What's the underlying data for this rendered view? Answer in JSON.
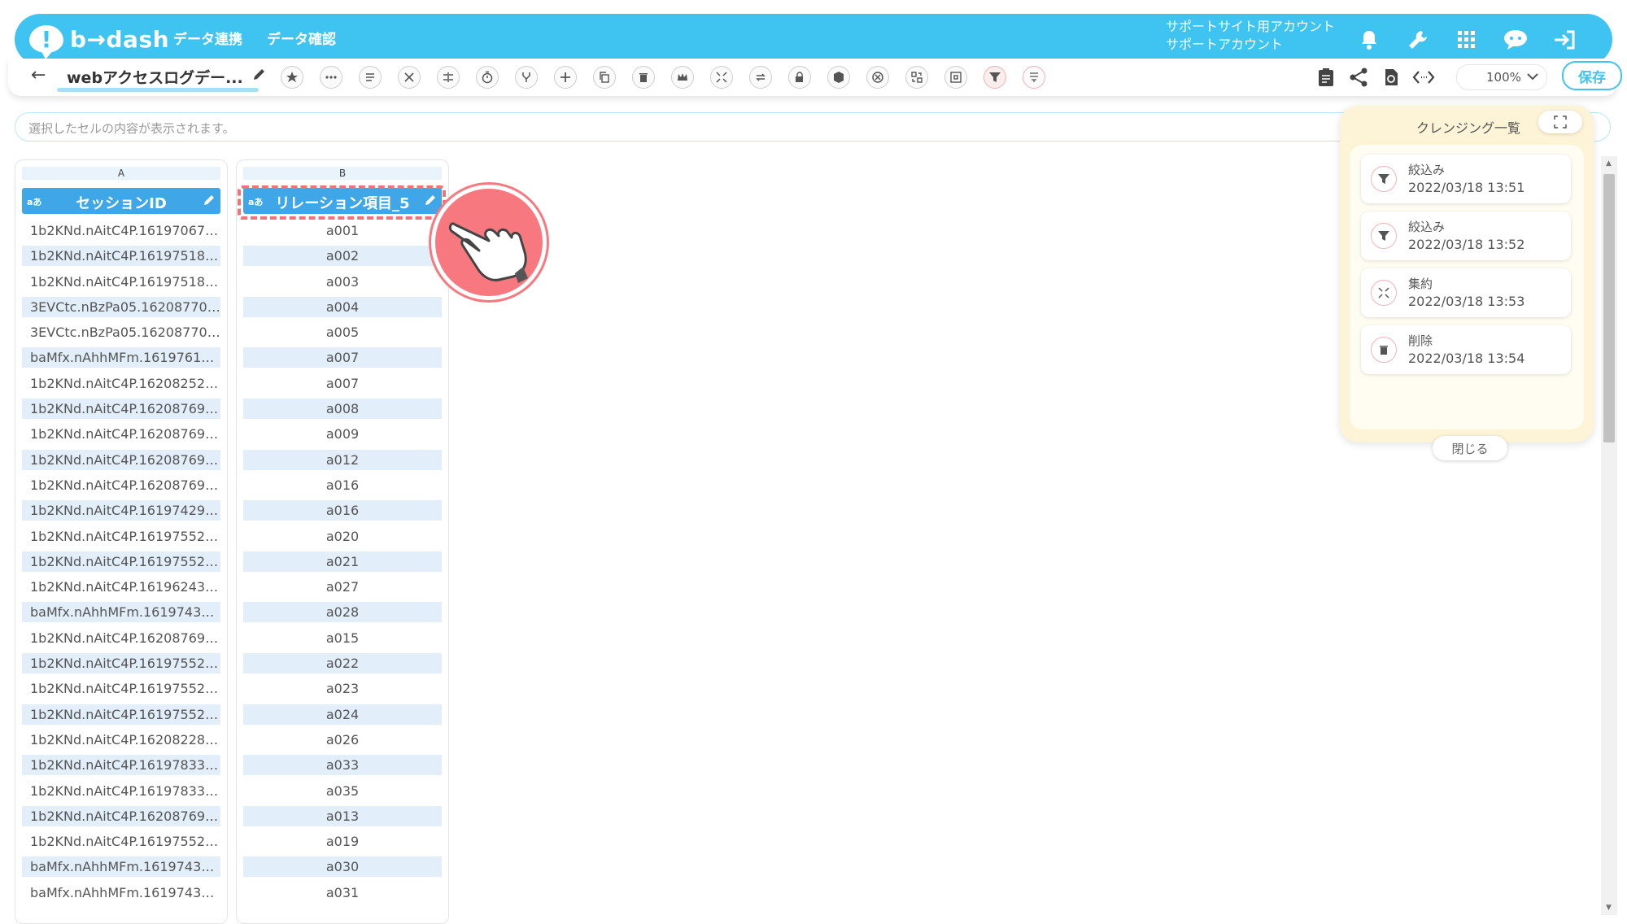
{
  "app": {
    "logo_text": "b→dash",
    "nav": [
      "データ連携",
      "データ確認"
    ],
    "account_line1": "サポートサイト用アカウント",
    "account_line2": "サポートアカウント"
  },
  "toolbar": {
    "back_icon": "←",
    "doc_title": "webアクセスログデー...",
    "zoom_value": "100%",
    "save_label": "保存"
  },
  "cellbar": {
    "placeholder": "選択したセルの内容が表示されます。"
  },
  "grid": {
    "columns": [
      {
        "letter": "A",
        "type_icon": "aあ",
        "header": "セッションID",
        "rows": [
          "1b2KNd.nAitC4P.161970677...",
          "1b2KNd.nAitC4P.161975180...",
          "1b2KNd.nAitC4P.161975180...",
          "3EVCtc.nBzPa05.162087702...",
          "3EVCtc.nBzPa05.162087702...",
          "baMfx.nAhhMFm.161976133...",
          "1b2KNd.nAitC4P.162082526...",
          "1b2KNd.nAitC4P.162087690...",
          "1b2KNd.nAitC4P.162087690...",
          "1b2KNd.nAitC4P.162087690...",
          "1b2KNd.nAitC4P.162087690...",
          "1b2KNd.nAitC4P.161974291...",
          "1b2KNd.nAitC4P.161975521...",
          "1b2KNd.nAitC4P.161975521...",
          "1b2KNd.nAitC4P.161962432...",
          "baMfx.nAhhMFm.161974348...",
          "1b2KNd.nAitC4P.162087690...",
          "1b2KNd.nAitC4P.161975521...",
          "1b2KNd.nAitC4P.161975521...",
          "1b2KNd.nAitC4P.161975521...",
          "1b2KNd.nAitC4P.162082280...",
          "1b2KNd.nAitC4P.161978330...",
          "1b2KNd.nAitC4P.161978330...",
          "1b2KNd.nAitC4P.162087690...",
          "1b2KNd.nAitC4P.161975521...",
          "baMfx.nAhhMFm.161974348...",
          "baMfx.nAhhMFm.161974348..."
        ]
      },
      {
        "letter": "B",
        "type_icon": "aあ",
        "header": "リレーション項目_5",
        "rows": [
          "a001",
          "a002",
          "a003",
          "a004",
          "a005",
          "a007",
          "a007",
          "a008",
          "a009",
          "a012",
          "a016",
          "a016",
          "a020",
          "a021",
          "a027",
          "a028",
          "a015",
          "a022",
          "a023",
          "a024",
          "a026",
          "a033",
          "a035",
          "a013",
          "a019",
          "a030",
          "a031"
        ]
      }
    ]
  },
  "panel": {
    "title": "クレンジング一覧",
    "steps": [
      {
        "name": "絞込み",
        "date": "2022/03/18 13:51",
        "icon": "filter-icon"
      },
      {
        "name": "絞込み",
        "date": "2022/03/18 13:52",
        "icon": "filter-icon"
      },
      {
        "name": "集約",
        "date": "2022/03/18 13:53",
        "icon": "aggregate-icon"
      },
      {
        "name": "削除",
        "date": "2022/03/18 13:54",
        "icon": "trash-icon"
      }
    ],
    "close_label": "閉じる"
  },
  "colors": {
    "brand": "#3fc4f2",
    "header_blue": "#3fa7e8",
    "highlight": "#f0727a",
    "panel_bg": "#fdf3d6"
  }
}
